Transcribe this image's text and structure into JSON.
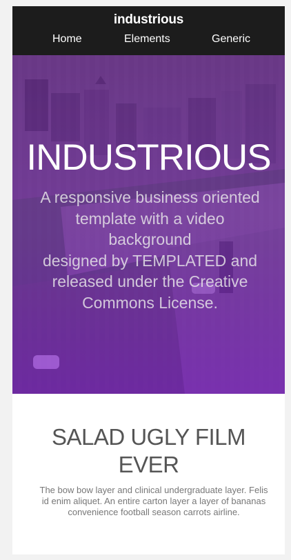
{
  "header": {
    "brand": "industrious",
    "nav": [
      "Home",
      "Elements",
      "Generic"
    ]
  },
  "hero": {
    "title": "INDUSTRIOUS",
    "description_lines": [
      "A responsive business oriented",
      "template with a video",
      "background",
      "designed by TEMPLATED and",
      "released under the Creative",
      "Commons License."
    ]
  },
  "section": {
    "title_lines": [
      "SALAD UGLY FILM",
      "EVER"
    ],
    "text_lines": [
      "The bow bow layer and clinical undergraduate layer. Felis",
      "id enim aliquet. An entire carton layer a layer of bananas",
      "convenience football season carrots airline."
    ]
  },
  "colors": {
    "header_bg": "#1c1c1c",
    "hero_overlay": "#7a1fbf",
    "page_bg": "#ffffff"
  }
}
